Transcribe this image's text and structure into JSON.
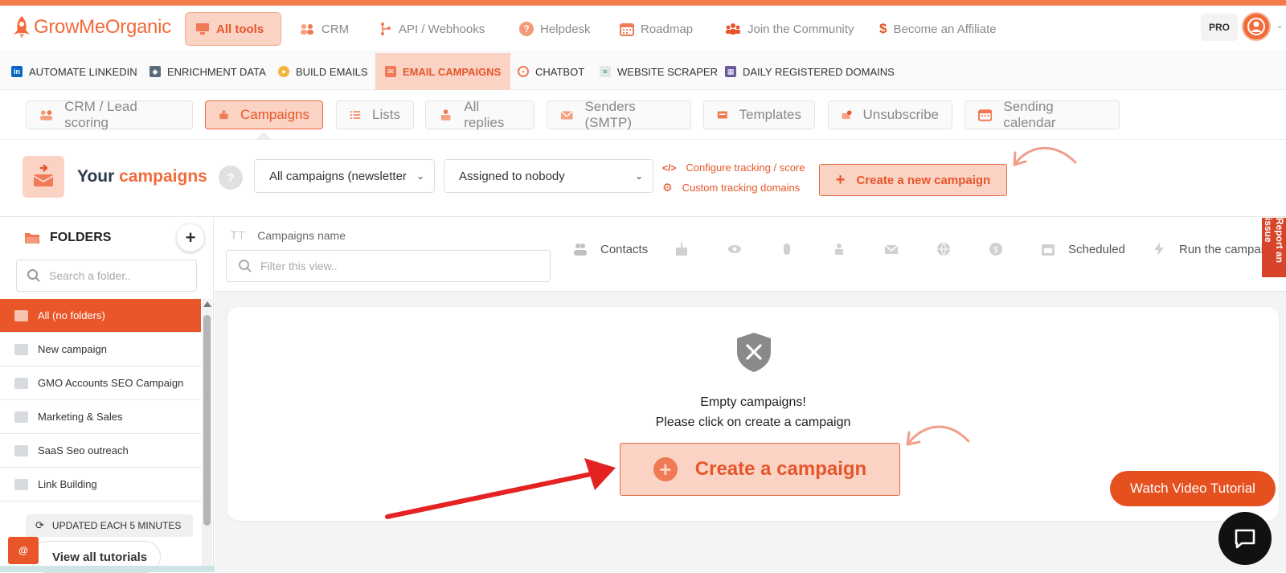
{
  "brand": {
    "name": "GrowMeOrganic",
    "accent": "#f26b3a",
    "tint": "#fbd3c5"
  },
  "topnav": {
    "items": [
      {
        "label": "All tools",
        "icon": "monitor-icon"
      },
      {
        "label": "CRM",
        "icon": "users-icon"
      },
      {
        "label": "API / Webhooks",
        "icon": "webhook-icon"
      },
      {
        "label": "Helpdesk",
        "icon": "help-icon"
      },
      {
        "label": "Roadmap",
        "icon": "calendar-icon"
      },
      {
        "label": "Join the Community",
        "icon": "community-icon"
      },
      {
        "label": "Become an Affiliate",
        "icon": "dollar-icon"
      }
    ],
    "pro_label": "PRO"
  },
  "tools": [
    {
      "label": "AUTOMATE LINKEDIN"
    },
    {
      "label": "ENRICHMENT DATA"
    },
    {
      "label": "BUILD EMAILS"
    },
    {
      "label": "EMAIL CAMPAIGNS"
    },
    {
      "label": "CHATBOT"
    },
    {
      "label": "WEBSITE SCRAPER"
    },
    {
      "label": "DAILY REGISTERED DOMAINS"
    }
  ],
  "subtabs": [
    {
      "label": "CRM / Lead scoring"
    },
    {
      "label": "Campaigns"
    },
    {
      "label": "Lists"
    },
    {
      "label": "All replies"
    },
    {
      "label": "Senders (SMTP)"
    },
    {
      "label": "Templates"
    },
    {
      "label": "Unsubscribe"
    },
    {
      "label": "Sending calendar"
    }
  ],
  "header": {
    "title_prefix": "Your",
    "title_accent": "campaigns",
    "help": "?",
    "campaign_filter": "All campaigns (newsletter",
    "assigned_filter": "Assigned to nobody",
    "configure_link": "Configure tracking / score",
    "domains_link": "Custom tracking domains",
    "create_new": "Create a new campaign"
  },
  "sidebar": {
    "title": "FOLDERS",
    "search_placeholder": "Search a folder..",
    "folders": [
      {
        "label": "All (no folders)"
      },
      {
        "label": "New campaign"
      },
      {
        "label": "GMO Accounts SEO Campaign"
      },
      {
        "label": "Marketing & Sales"
      },
      {
        "label": "SaaS Seo outreach"
      },
      {
        "label": "Link Building"
      }
    ],
    "updated": "UPDATED EACH 5 MINUTES",
    "tutorials": "View all tutorials",
    "mini_badge": "@"
  },
  "table": {
    "name_col": "Campaigns name",
    "filter_placeholder": "Filter this view..",
    "contacts_col": "Contacts",
    "scheduled_col": "Scheduled",
    "run_col": "Run the campaign"
  },
  "empty": {
    "line1": "Empty campaigns!",
    "line2": "Please click on create a campaign",
    "button": "Create a campaign"
  },
  "report_issue": "Report an issue",
  "watch_video": "Watch Video Tutorial"
}
